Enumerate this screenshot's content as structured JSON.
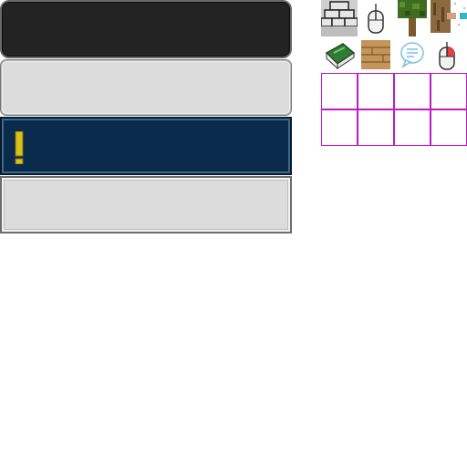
{
  "panels": [
    {
      "name": "dark-panel",
      "color": "#232323"
    },
    {
      "name": "light-panel",
      "color": "#dcdcdc"
    },
    {
      "name": "notice-panel",
      "color": "#0b2b4d",
      "icon": "exclamation-icon"
    },
    {
      "name": "light-panel-2",
      "color": "#dcdcdc"
    }
  ],
  "sprites": [
    "stone-brick-icon",
    "mouse-icon",
    "tree-icon",
    "bark-icon",
    "book-icon",
    "wood-plank-icon",
    "speech-bubble-icon",
    "mouse-right-click-icon"
  ],
  "grid": {
    "rows": 2,
    "cols": 4,
    "border_color": "#c218c8"
  },
  "colors": {
    "warning": "#d8c21a"
  }
}
